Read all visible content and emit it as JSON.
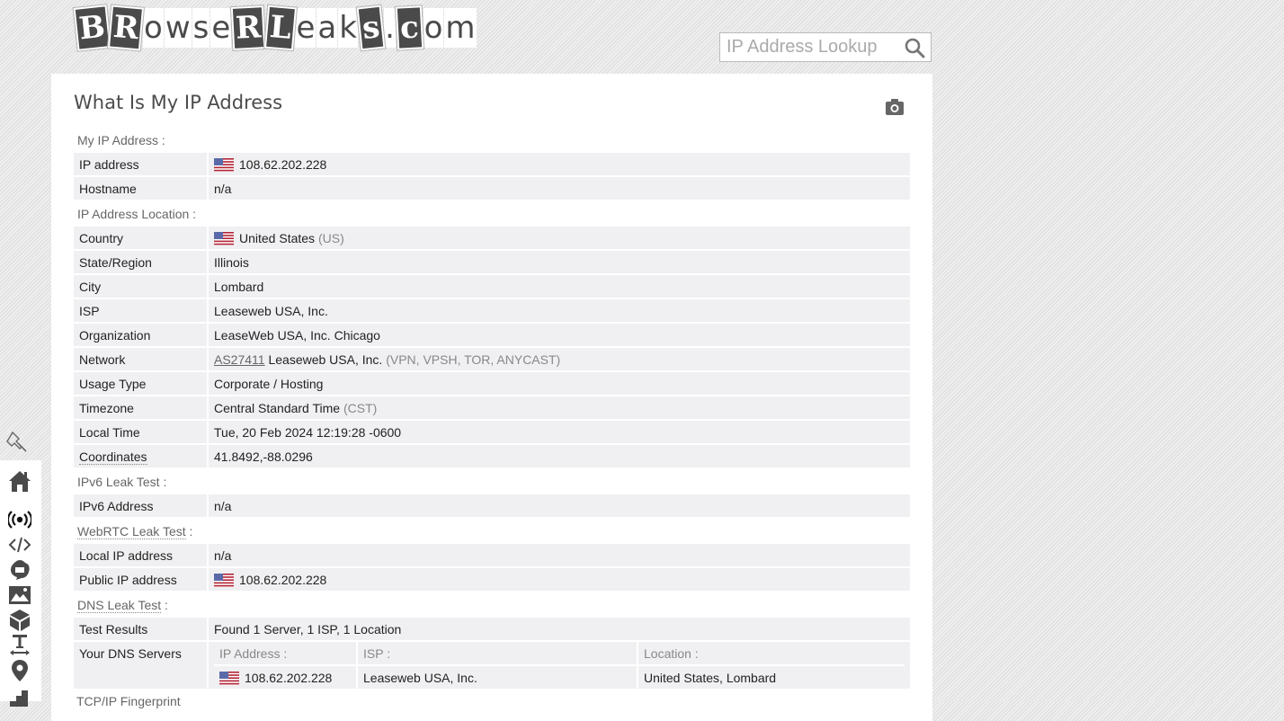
{
  "header": {
    "logo_text": "BrowserLeaks.com",
    "logo_letters": [
      "B",
      "R",
      "o",
      "w",
      "s",
      "e",
      "R",
      "L",
      "e",
      "a",
      "k",
      "s",
      ".",
      "c",
      "o",
      "m"
    ],
    "search_placeholder": "IP Address Lookup",
    "search_icon": "search-icon"
  },
  "page": {
    "title": "What Is My IP Address",
    "screenshot_icon": "camera-icon"
  },
  "sections": {
    "my_ip": {
      "heading": "My IP Address :",
      "rows": [
        {
          "label": "IP address",
          "value": "108.62.202.228",
          "flag": "us"
        },
        {
          "label": "Hostname",
          "value": "n/a"
        }
      ]
    },
    "location": {
      "heading": "IP Address Location :",
      "rows": [
        {
          "label": "Country",
          "value": "United States",
          "suffix": "(US)",
          "flag": "us"
        },
        {
          "label": "State/Region",
          "value": "Illinois"
        },
        {
          "label": "City",
          "value": "Lombard"
        },
        {
          "label": "ISP",
          "value": "Leaseweb USA, Inc."
        },
        {
          "label": "Organization",
          "value": "LeaseWeb USA, Inc. Chicago"
        },
        {
          "label": "Network",
          "link": "AS27411",
          "value": "Leaseweb USA, Inc.",
          "suffix": "(VPN, VPSH, TOR, ANYCAST)"
        },
        {
          "label": "Usage Type",
          "value": "Corporate / Hosting"
        },
        {
          "label": "Timezone",
          "value": "Central Standard Time",
          "suffix": "(CST)"
        },
        {
          "label": "Local Time",
          "value": "Tue, 20 Feb 2024 12:19:28 -0600"
        },
        {
          "label": "Coordinates",
          "value": "41.8492,-88.0296"
        }
      ]
    },
    "ipv6": {
      "heading": "IPv6 Leak Test :",
      "rows": [
        {
          "label": "IPv6 Address",
          "value": "n/a"
        }
      ]
    },
    "webrtc": {
      "heading": "WebRTC Leak Test",
      "heading_colon": " :",
      "rows": [
        {
          "label": "Local IP address",
          "value": "n/a"
        },
        {
          "label": "Public IP address",
          "value": "108.62.202.228",
          "flag": "us"
        }
      ]
    },
    "dns": {
      "heading": "DNS Leak Test",
      "heading_colon": " :",
      "test_results_label": "Test Results",
      "test_results_value": "Found 1 Server, 1 ISP, 1 Location",
      "servers_label": "Your DNS Servers",
      "columns": [
        "IP Address :",
        "ISP :",
        "Location :"
      ],
      "servers": [
        {
          "ip": "108.62.202.228",
          "isp": "Leaseweb USA, Inc.",
          "location": "United States, Lombard",
          "flag": "us"
        }
      ]
    },
    "next_heading_partial": "TCP/IP Fingerprint"
  },
  "sidebar": {
    "pin_icon": "pin-icon",
    "items": [
      {
        "name": "home-icon"
      },
      {
        "name": "ip-broadcast-icon",
        "active": true
      },
      {
        "name": "code-icon"
      },
      {
        "name": "canvas-fingerprint-icon"
      },
      {
        "name": "image-icon"
      },
      {
        "name": "webgl-cube-icon"
      },
      {
        "name": "font-text-width-icon"
      },
      {
        "name": "geolocation-pin-icon"
      },
      {
        "name": "stairs-icon"
      }
    ]
  },
  "colors": {
    "panel_bg": "#ffffff",
    "row_bg": "#f0f0f2",
    "heading_text": "#666666",
    "title_text": "#4c4c4c",
    "icon_dark": "#4a4a4a"
  }
}
